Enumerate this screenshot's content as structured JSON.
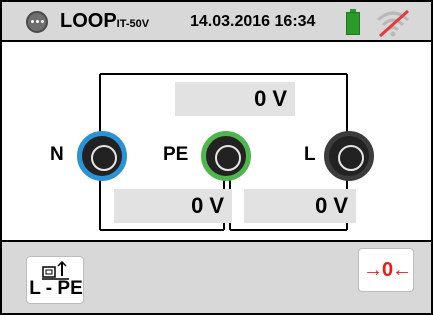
{
  "header": {
    "title": "LOOP",
    "title_sub": "IT-50V",
    "datetime": "14.03.2016 16:34",
    "menu_icon": "more-dots-icon",
    "battery_icon": "battery-icon",
    "battery_color": "#2a9a2a",
    "wifi_icon": "wifi-off-icon"
  },
  "measurement": {
    "top_value": "0",
    "top_unit": "V",
    "left_value": "0",
    "left_unit": "V",
    "right_value": "0",
    "right_unit": "V"
  },
  "terminals": {
    "n_label": "N",
    "n_color": "#2a93d5",
    "pe_label": "PE",
    "pe_color": "#4fb64d",
    "l_label": "L",
    "l_color": "#3c3c3c"
  },
  "footer": {
    "mode_label": "L - PE",
    "mode_icon": "probe-mode-icon",
    "zero_label": "→0←",
    "zero_color": "#ee1a1a"
  }
}
